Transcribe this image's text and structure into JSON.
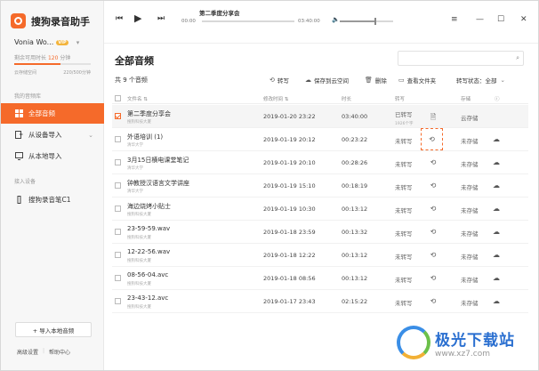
{
  "app": {
    "title": "搜狗录音助手",
    "user_name": "Vonia Wo...",
    "vip_badge": "VIP",
    "remain_label": "剩余可用时长",
    "remain_value": "120",
    "remain_unit": "分钟",
    "time_usage_fraction": 0.6,
    "storage_label": "云存储空间",
    "storage_value": "220/500分钟"
  },
  "sidebar": {
    "library_label": "我的音频库",
    "items": [
      {
        "label": "全部音频",
        "icon": "audio-list-icon",
        "active": true
      },
      {
        "label": "从设备导入",
        "icon": "device-import-icon",
        "active": false
      },
      {
        "label": "从本地导入",
        "icon": "monitor-icon",
        "active": false
      }
    ],
    "devices_label": "接入设备",
    "device": {
      "label": "搜狗录音笔C1",
      "icon": "recorder-pen-icon"
    },
    "import_button": "+ 导入本地音频",
    "footer": {
      "settings": "高级设置",
      "help": "帮助中心"
    }
  },
  "player": {
    "track_title": "第二季度分享会",
    "time_start": "00:00",
    "time_end": "03:40:00",
    "progress_fraction": 0.0,
    "volume_fraction": 0.65
  },
  "main": {
    "title": "全部音频",
    "count": "共 9 个音频",
    "search_placeholder": "",
    "toolbar": {
      "transcribe": "转写",
      "save_cloud": "保存到云空间",
      "delete": "删除",
      "view_folder": "查看文件夹",
      "transcribe_status_label": "转写状态：",
      "transcribe_status_value": "全部"
    },
    "columns": {
      "name": "文件名",
      "modified": "修改时间",
      "duration": "时长",
      "transcribe": "转写",
      "storage": "存储"
    },
    "rows": [
      {
        "name": "第二季度分享会",
        "source": "搜狗科技大厦",
        "date": "2019-01-20  23:22",
        "duration": "03:40:00",
        "status": "已转写",
        "status_sub": "1926个字",
        "storage": "云存储",
        "checked": true,
        "selected": true,
        "action_icon": "document-icon",
        "cloud": false
      },
      {
        "name": "外语培训 (1)",
        "source": "清华大学",
        "date": "2019-01-19  20:12",
        "duration": "00:23:22",
        "status": "未转写",
        "status_sub": "",
        "storage": "未存储",
        "checked": false,
        "selected": false,
        "action_icon": "transcribe-icon",
        "cloud": true
      },
      {
        "name": "3月15日横电课堂笔记",
        "source": "清华大学",
        "date": "2019-01-19  20:10",
        "duration": "00:28:26",
        "status": "未转写",
        "status_sub": "",
        "storage": "未存储",
        "checked": false,
        "selected": false,
        "action_icon": "transcribe-icon",
        "cloud": true
      },
      {
        "name": "钟教授汉语言文学讲座",
        "source": "清华大学",
        "date": "2019-01-19  15:10",
        "duration": "00:18:19",
        "status": "未转写",
        "status_sub": "",
        "storage": "未存储",
        "checked": false,
        "selected": false,
        "action_icon": "transcribe-icon",
        "cloud": true
      },
      {
        "name": "海边烧烤小贴士",
        "source": "搜狗科技大厦",
        "date": "2019-01-19  10:30",
        "duration": "00:13:12",
        "status": "未转写",
        "status_sub": "",
        "storage": "未存储",
        "checked": false,
        "selected": false,
        "action_icon": "transcribe-icon",
        "cloud": true
      },
      {
        "name": "23-59-59.wav",
        "source": "搜狗科技大厦",
        "date": "2019-01-18  23:59",
        "duration": "00:13:32",
        "status": "未转写",
        "status_sub": "",
        "storage": "未存储",
        "checked": false,
        "selected": false,
        "action_icon": "transcribe-icon",
        "cloud": true
      },
      {
        "name": "12-22-56.wav",
        "source": "搜狗科技大厦",
        "date": "2019-01-18  12:22",
        "duration": "00:13:12",
        "status": "未转写",
        "status_sub": "",
        "storage": "未存储",
        "checked": false,
        "selected": false,
        "action_icon": "transcribe-icon",
        "cloud": true
      },
      {
        "name": "08-56-04.avc",
        "source": "搜狗科技大厦",
        "date": "2019-01-18  08:56",
        "duration": "00:13:12",
        "status": "未转写",
        "status_sub": "",
        "storage": "未存储",
        "checked": false,
        "selected": false,
        "action_icon": "transcribe-icon",
        "cloud": true
      },
      {
        "name": "23-43-12.avc",
        "source": "搜狗科技大厦",
        "date": "2019-01-17  23:43",
        "duration": "02:15:22",
        "status": "未转写",
        "status_sub": "",
        "storage": "未存储",
        "checked": false,
        "selected": false,
        "action_icon": "transcribe-icon",
        "cloud": true
      }
    ]
  },
  "watermark": {
    "name": "极光下载站",
    "url": "www.xz7.com"
  },
  "colors": {
    "accent": "#f56a2a",
    "vip": "#f3b43c"
  }
}
